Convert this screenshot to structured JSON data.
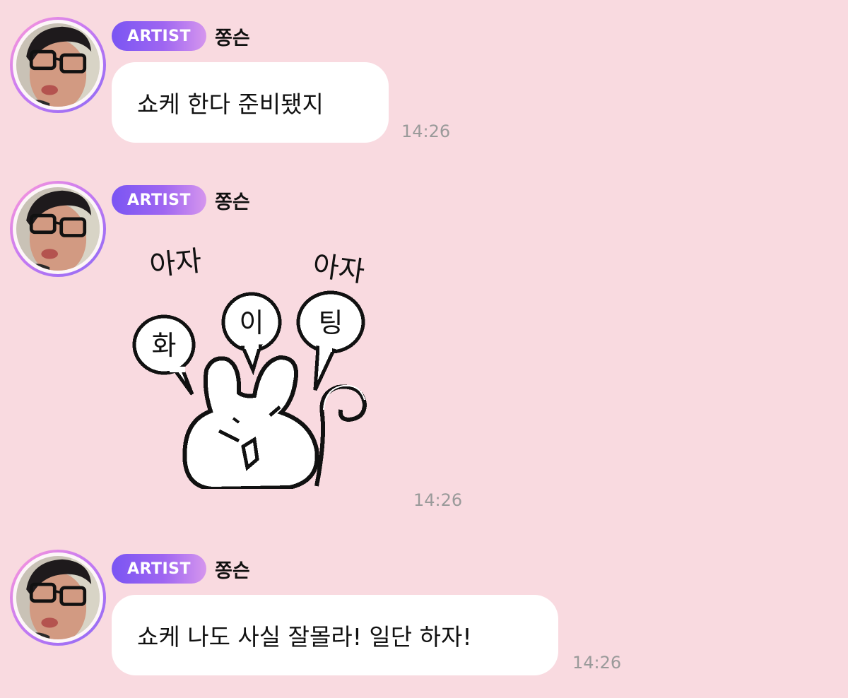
{
  "messages": [
    {
      "badge": "ARTIST",
      "sender": "쫑슨",
      "text": "쇼케 한다 준비됐지",
      "time": "14:26"
    },
    {
      "badge": "ARTIST",
      "sender": "쫑슨",
      "sticker": {
        "icon": "bunny-fighting-sticker",
        "lettering": [
          "아자",
          "화",
          "이",
          "팅",
          "아자"
        ]
      },
      "time": "14:26"
    },
    {
      "badge": "ARTIST",
      "sender": "쫑슨",
      "text": "쇼케 나도 사실 잘몰라! 일단 하자!",
      "time": "14:26"
    }
  ],
  "colors": {
    "background": "#f9dae0",
    "badge_start": "#7a55f3",
    "badge_end": "#d596ee",
    "bubble": "#ffffff",
    "time": "#9a9a9a"
  }
}
